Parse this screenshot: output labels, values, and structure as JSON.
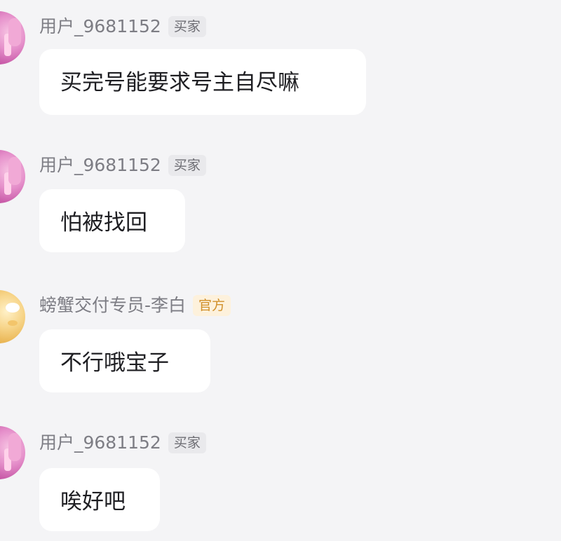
{
  "messages": [
    {
      "sender": "用户_9681152",
      "role_badge": "买家",
      "text": "买完号能要求号主自尽嘛",
      "role_type": "buyer"
    },
    {
      "sender": "用户_9681152",
      "role_badge": "买家",
      "text": "怕被找回",
      "role_type": "buyer"
    },
    {
      "sender": "螃蟹交付专员-李白",
      "role_badge": "官方",
      "text": "不行哦宝子",
      "role_type": "official"
    },
    {
      "sender": "用户_9681152",
      "role_badge": "买家",
      "text": "唉好吧",
      "role_type": "buyer"
    }
  ],
  "colors": {
    "background": "#f4f4f6",
    "bubble": "#ffffff",
    "name_text": "#7d7d84",
    "buyer_badge_bg": "#e9e9ec",
    "official_badge_bg": "#fdf1dc",
    "official_badge_text": "#d1902a"
  },
  "icons": {
    "buyer_avatar": "pink-character-avatar",
    "official_avatar": "yellow-cat-avatar"
  }
}
